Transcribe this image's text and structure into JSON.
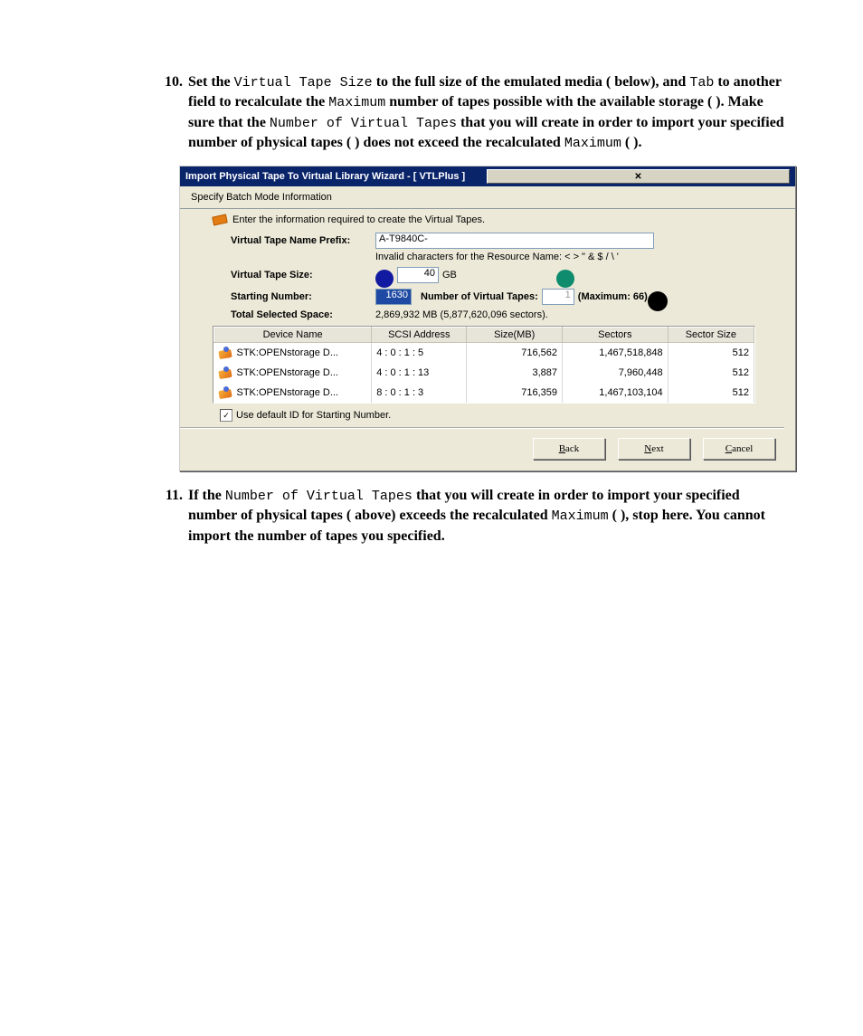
{
  "step10": {
    "number": "10.",
    "prefix": "Set the ",
    "code1": "Virtual Tape Size",
    "mid1": " to the full size of the emulated media (   below), and ",
    "code2": "Tab",
    "mid2": " to another field to recalculate the ",
    "code3": "Maximum",
    "mid3": " number of tapes possible with the available storage (  ). Make sure that the ",
    "code4": "Number of Virtual Tapes",
    "mid4": " that you will create in order to import your specified number of physical tapes (  ) does not exceed the recalculated ",
    "code5": "Maximum",
    "suffix": " (  )."
  },
  "wizard": {
    "title": "Import Physical Tape To Virtual Library Wizard - [ VTLPlus ]",
    "close_x": "✕",
    "subtitle": "Specify Batch Mode Information",
    "intro": "Enter the information required to create the Virtual Tapes.",
    "prefix_label": "Virtual Tape Name Prefix:",
    "prefix_value": "A-T9840C-",
    "invalid_note": "Invalid characters for the Resource Name: < > \" & $ / \\ '",
    "size_label": "Virtual Tape Size:",
    "size_value": "40",
    "size_unit": "GB",
    "start_label": "Starting Number:",
    "start_value": "1630",
    "numtapes_label": "Number of Virtual Tapes:",
    "numtapes_value": "1",
    "max_label": "(Maximum: 66)",
    "total_label": "Total Selected Space:",
    "total_value": "2,869,932 MB (5,877,620,096 sectors).",
    "table": {
      "headers": [
        "Device Name",
        "SCSI Address",
        "Size(MB)",
        "Sectors",
        "Sector Size"
      ],
      "rows": [
        {
          "name": "STK:OPENstorage D...",
          "scsi": "4 : 0 : 1 : 5",
          "size": "716,562",
          "sectors": "1,467,518,848",
          "ss": "512"
        },
        {
          "name": "STK:OPENstorage D...",
          "scsi": "4 : 0 : 1 : 13",
          "size": "3,887",
          "sectors": "7,960,448",
          "ss": "512"
        },
        {
          "name": "STK:OPENstorage D...",
          "scsi": "8 : 0 : 1 : 3",
          "size": "716,359",
          "sectors": "1,467,103,104",
          "ss": "512"
        }
      ]
    },
    "checkbox_label": "Use default ID for Starting Number.",
    "checkbox_mark": "✓",
    "btn_back": "Back",
    "btn_next": "Next",
    "btn_cancel": "Cancel"
  },
  "step11": {
    "number": "11.",
    "prefix": "If the ",
    "code1": "Number of Virtual Tapes",
    "mid1": " that you will create in order to import your specified number of physical tapes (   above) exceeds the recalculated ",
    "code2": "Maximum",
    "suffix": " (  ), stop here. You cannot import the number of tapes you specified."
  }
}
